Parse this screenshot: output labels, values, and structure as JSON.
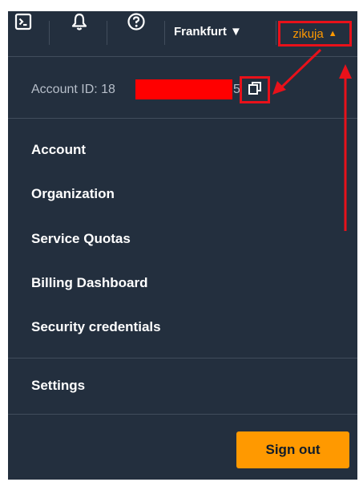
{
  "topbar": {
    "cloudshell_icon": "terminal-icon",
    "notifications_icon": "bell-icon",
    "help_icon": "help-circle-icon",
    "region_label": "Frankfurt ▼",
    "username": "zikuja",
    "user_caret": "▲"
  },
  "account": {
    "id_prefix": "Account ID: 18",
    "id_suffix": "5",
    "copy_icon": "copy-icon"
  },
  "menu": {
    "items": [
      {
        "label": "Account"
      },
      {
        "label": "Organization"
      },
      {
        "label": "Service Quotas"
      },
      {
        "label": "Billing Dashboard"
      },
      {
        "label": "Security credentials"
      }
    ],
    "settings_label": "Settings",
    "signout_label": "Sign out"
  },
  "colors": {
    "panel_bg": "#232f3e",
    "accent": "#ff9900",
    "annotation_red": "#e8111a"
  }
}
